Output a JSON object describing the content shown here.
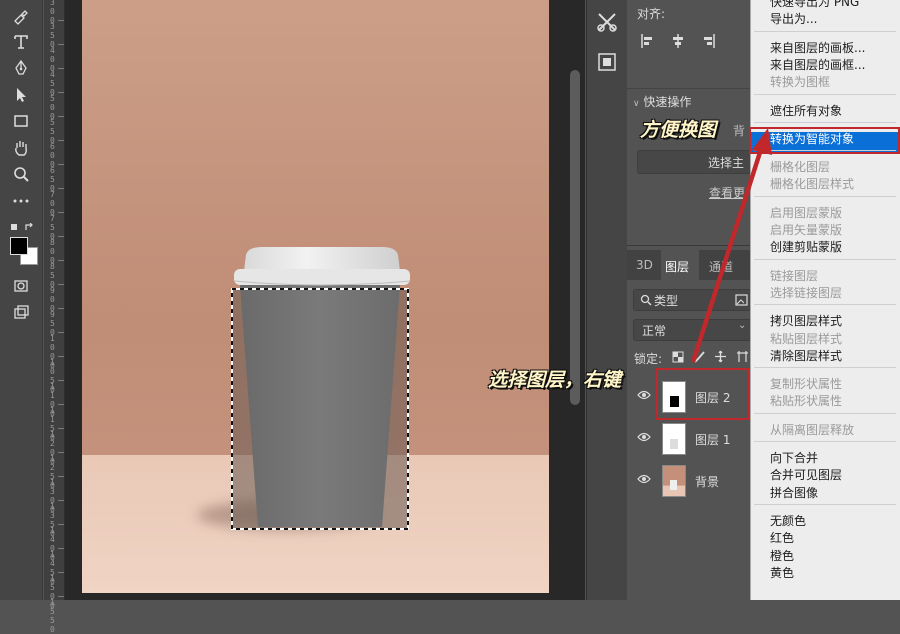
{
  "toolbar": {
    "tools": [
      "healing-brush-icon",
      "type-icon",
      "pen-icon",
      "path-select-icon",
      "rectangle-icon",
      "hand-icon",
      "zoom-icon",
      "more-icon"
    ],
    "extra": [
      "quick-mask-icon",
      "screen-mode-icon"
    ],
    "foreground": "#000000",
    "background": "#ffffff"
  },
  "ruler": {
    "labels": [
      "300",
      "350",
      "400",
      "450",
      "500",
      "550",
      "600",
      "650",
      "700",
      "750",
      "800",
      "850",
      "900",
      "950",
      "1000",
      "1050",
      "1100",
      "1150",
      "1200",
      "1250",
      "1300",
      "1350",
      "1400",
      "1450",
      "1500",
      "1550"
    ]
  },
  "properties": {
    "align_label": "对齐:",
    "quick_actions_label": "快速操作",
    "partial_text": "背",
    "select_subject_partial": "选择主",
    "view_more_partial": "查看更"
  },
  "layers_panel": {
    "tabs": [
      "3D",
      "图层",
      "通道"
    ],
    "filter_kind": "类型",
    "blend_mode": "正常",
    "lock_label": "锁定:",
    "layers": [
      {
        "name": "图层 2",
        "visible": true
      },
      {
        "name": "图层 1",
        "visible": true
      },
      {
        "name": "背景",
        "visible": true
      }
    ]
  },
  "context_menu": {
    "groups": [
      [
        {
          "label": "快速导出为 PNG",
          "enabled": true
        },
        {
          "label": "导出为...",
          "enabled": true
        }
      ],
      [
        {
          "label": "来自图层的画板...",
          "enabled": true
        },
        {
          "label": "来自图层的画框...",
          "enabled": true
        },
        {
          "label": "转换为图框",
          "enabled": false
        }
      ],
      [
        {
          "label": "遮住所有对象",
          "enabled": true
        }
      ],
      [
        {
          "label": "转换为智能对象",
          "enabled": true,
          "highlighted": true
        }
      ],
      [
        {
          "label": "栅格化图层",
          "enabled": false
        },
        {
          "label": "栅格化图层样式",
          "enabled": false
        }
      ],
      [
        {
          "label": "启用图层蒙版",
          "enabled": false
        },
        {
          "label": "启用矢量蒙版",
          "enabled": false
        },
        {
          "label": "创建剪贴蒙版",
          "enabled": true
        }
      ],
      [
        {
          "label": "链接图层",
          "enabled": false
        },
        {
          "label": "选择链接图层",
          "enabled": false
        }
      ],
      [
        {
          "label": "拷贝图层样式",
          "enabled": true
        },
        {
          "label": "粘贴图层样式",
          "enabled": false
        },
        {
          "label": "清除图层样式",
          "enabled": true
        }
      ],
      [
        {
          "label": "复制形状属性",
          "enabled": false
        },
        {
          "label": "粘贴形状属性",
          "enabled": false
        }
      ],
      [
        {
          "label": "从隔离图层释放",
          "enabled": false
        }
      ],
      [
        {
          "label": "向下合并",
          "enabled": true
        },
        {
          "label": "合并可见图层",
          "enabled": true
        },
        {
          "label": "拼合图像",
          "enabled": true
        }
      ],
      [
        {
          "label": "无颜色",
          "enabled": true
        },
        {
          "label": "红色",
          "enabled": true
        },
        {
          "label": "橙色",
          "enabled": true
        },
        {
          "label": "黄色",
          "enabled": true
        }
      ]
    ]
  },
  "annotations": {
    "convert_note": "方便换图",
    "select_note": "选择图层，右键",
    "color": "#c0282b"
  }
}
